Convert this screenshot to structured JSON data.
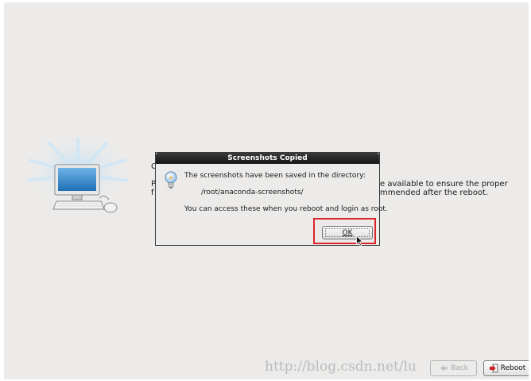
{
  "background": {
    "fragment_c": "C",
    "fragment_p": "P",
    "fragment_f": "f",
    "line1": "e available to ensure the proper",
    "line2": "mmended after the reboot."
  },
  "dialog": {
    "title": "Screenshots Copied",
    "message": "The screenshots have been saved in the directory:",
    "path": "/root/anaconda-screenshots/",
    "message2": "You can access these when you reboot and login as root.",
    "ok_label": "OK",
    "icon": "lightbulb-icon"
  },
  "footer": {
    "back_label": "Back",
    "reboot_label": "Reboot"
  },
  "watermark": "http://blog.csdn.net/lu",
  "colors": {
    "highlight": "#d9262c",
    "titlebar": "#222222",
    "screen_bg": "#ecebea"
  }
}
